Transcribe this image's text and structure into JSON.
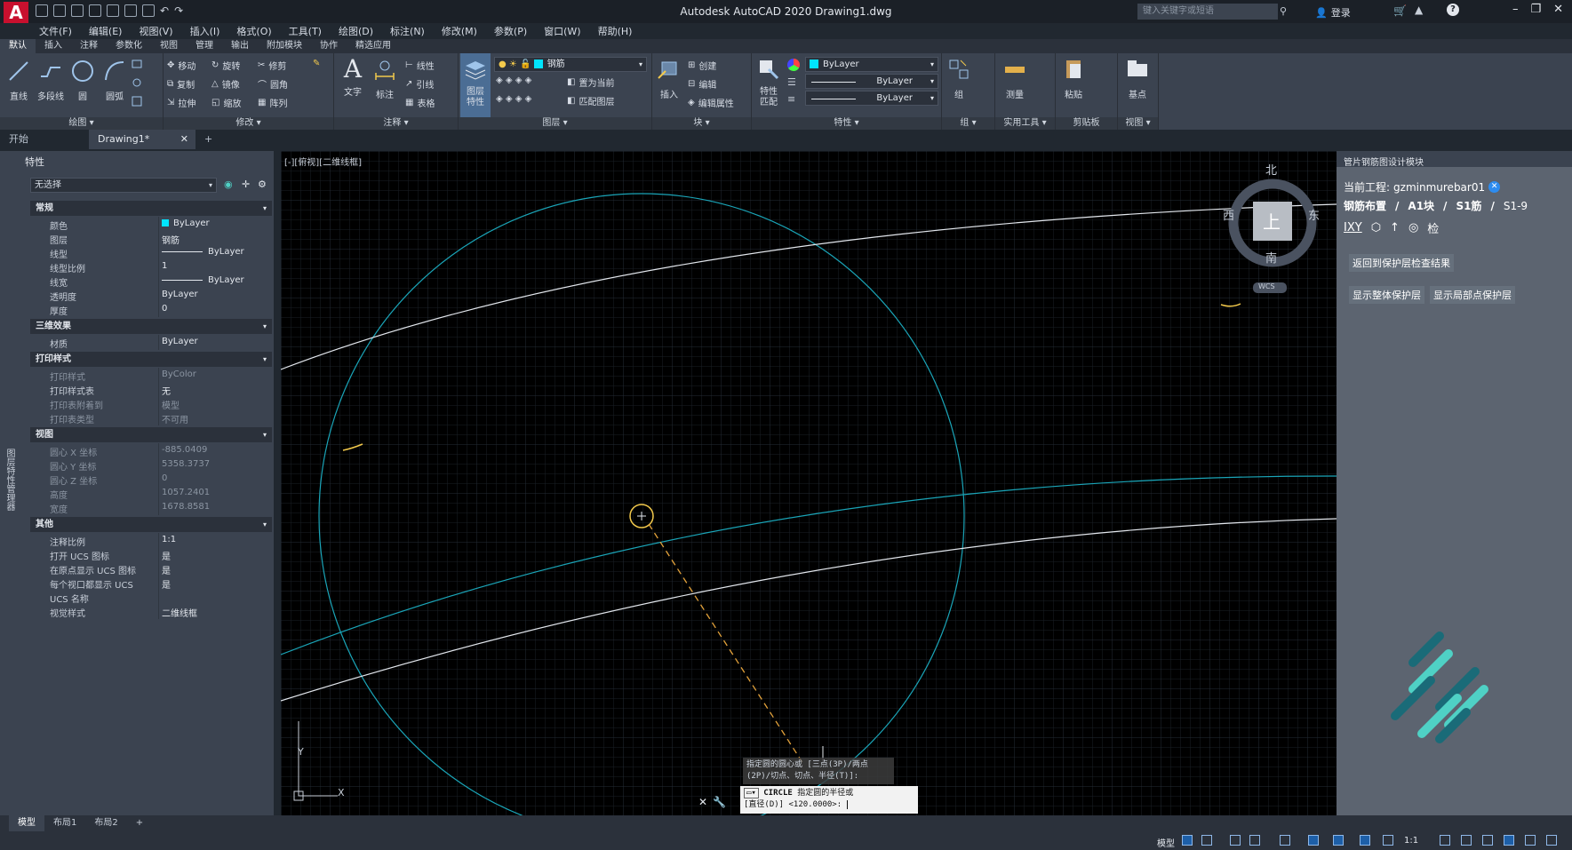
{
  "titlebar": {
    "app_title": "Autodesk AutoCAD 2020    Drawing1.dwg",
    "search_placeholder": "键入关键字或短语",
    "login": "登录",
    "logo": "A"
  },
  "menus": [
    "文件(F)",
    "编辑(E)",
    "视图(V)",
    "插入(I)",
    "格式(O)",
    "工具(T)",
    "绘图(D)",
    "标注(N)",
    "修改(M)",
    "参数(P)",
    "窗口(W)",
    "帮助(H)"
  ],
  "ribbon_tabs": [
    "默认",
    "插入",
    "注释",
    "参数化",
    "视图",
    "管理",
    "输出",
    "附加模块",
    "协作",
    "精选应用"
  ],
  "ribbon": {
    "draw": {
      "title": "绘图",
      "tools": [
        "直线",
        "多段线",
        "圆",
        "圆弧"
      ]
    },
    "modify": {
      "title": "修改",
      "tools": [
        "移动",
        "旋转",
        "修剪",
        "复制",
        "镜像",
        "圆角",
        "拉伸",
        "缩放",
        "阵列"
      ]
    },
    "annotation": {
      "title": "注释",
      "tools": [
        "文字",
        "标注",
        "线性",
        "引线",
        "表格"
      ]
    },
    "layers": {
      "title": "图层",
      "layer_props": "图层\n特性",
      "layer_name": "钢筋",
      "set_current": "置为当前",
      "match_layer": "匹配图层"
    },
    "block": {
      "title": "块",
      "insert": "插入",
      "create": "创建",
      "edit": "编辑",
      "edit_attr": "编辑属性"
    },
    "properties": {
      "title": "特性",
      "match": "特性\n匹配",
      "color": "ByLayer",
      "linetype": "ByLayer",
      "lineweight": "ByLayer"
    },
    "groups": {
      "title": "组",
      "group": "组"
    },
    "utilities": {
      "title": "实用工具",
      "measure": "测量"
    },
    "clipboard": {
      "title": "剪贴板",
      "paste": "粘贴"
    },
    "view": {
      "title": "视图",
      "base": "基点"
    }
  },
  "doc_tabs": [
    "开始",
    "Drawing1*"
  ],
  "properties_palette": {
    "title": "特性",
    "selection": "无选择",
    "side_label": "图层特性管理器",
    "sections": [
      {
        "name": "常规",
        "rows": [
          {
            "k": "颜色",
            "v": "ByLayer"
          },
          {
            "k": "图层",
            "v": "钢筋"
          },
          {
            "k": "线型",
            "v": "ByLayer"
          },
          {
            "k": "线型比例",
            "v": "1"
          },
          {
            "k": "线宽",
            "v": "ByLayer"
          },
          {
            "k": "透明度",
            "v": "ByLayer"
          },
          {
            "k": "厚度",
            "v": "0"
          }
        ]
      },
      {
        "name": "三维效果",
        "rows": [
          {
            "k": "材质",
            "v": "ByLayer"
          }
        ]
      },
      {
        "name": "打印样式",
        "rows": [
          {
            "k": "打印样式",
            "v": "ByColor"
          },
          {
            "k": "打印样式表",
            "v": "无"
          },
          {
            "k": "打印表附着到",
            "v": "模型"
          },
          {
            "k": "打印表类型",
            "v": "不可用"
          }
        ]
      },
      {
        "name": "视图",
        "rows": [
          {
            "k": "圆心 X 坐标",
            "v": "-885.0409"
          },
          {
            "k": "圆心 Y 坐标",
            "v": "5358.3737"
          },
          {
            "k": "圆心 Z 坐标",
            "v": "0"
          },
          {
            "k": "高度",
            "v": "1057.2401"
          },
          {
            "k": "宽度",
            "v": "1678.8581"
          }
        ]
      },
      {
        "name": "其他",
        "rows": [
          {
            "k": "注释比例",
            "v": "1:1"
          },
          {
            "k": "打开 UCS 图标",
            "v": "是"
          },
          {
            "k": "在原点显示 UCS 图标",
            "v": "是"
          },
          {
            "k": "每个视口都显示 UCS",
            "v": "是"
          },
          {
            "k": "UCS 名称",
            "v": ""
          },
          {
            "k": "视觉样式",
            "v": "二维线框"
          }
        ]
      }
    ]
  },
  "viewport": {
    "label": "[-][俯视][二维线框]",
    "viewcube": {
      "north": "北",
      "south": "南",
      "east": "东",
      "west": "西",
      "top": "上",
      "wcs": "WCS"
    },
    "ucs_x": "X",
    "ucs_y": "Y"
  },
  "command": {
    "history": "指定圆的圆心或 [三点(3P)/两点(2P)/切点、切点、半径(T)]:",
    "prompt_cmd": "CIRCLE",
    "prompt_text": "指定圆的半径或",
    "prompt_option": "[直径(D)] <120.0000>:"
  },
  "right_panel": {
    "title": "管片钢筋图设计模块",
    "project_label": "当前工程:",
    "project_name": "gzminmurebar01",
    "breadcrumb": [
      "钢筋布置",
      "A1块",
      "S1筋",
      "S1-9"
    ],
    "toolbar": [
      "IXY",
      "检"
    ],
    "btn_back": "返回到保护层检查结果",
    "btn_whole": "显示整体保护层",
    "btn_local": "显示局部点保护层"
  },
  "layout_tabs": [
    "模型",
    "布局1",
    "布局2"
  ],
  "status": {
    "model": "模型",
    "scale": "1:1"
  },
  "colors": {
    "accent_cyan": "#00e5ff",
    "brand_red": "#c8102e",
    "teal_logo": "#4fd1c5"
  }
}
